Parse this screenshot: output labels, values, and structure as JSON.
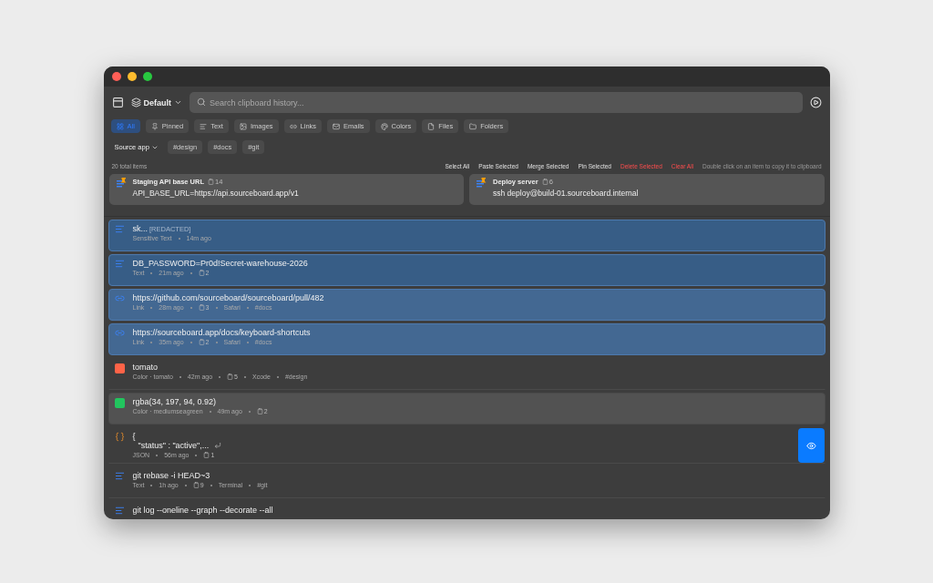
{
  "toolbar": {
    "profile": "Default",
    "search_placeholder": "Search clipboard history..."
  },
  "filters": [
    {
      "label": "All",
      "selected": true
    },
    {
      "label": "Pinned",
      "selected": false
    },
    {
      "label": "Text",
      "selected": false
    },
    {
      "label": "Images",
      "selected": false
    },
    {
      "label": "Links",
      "selected": false
    },
    {
      "label": "Emails",
      "selected": false
    },
    {
      "label": "Colors",
      "selected": false
    },
    {
      "label": "Files",
      "selected": false
    },
    {
      "label": "Folders",
      "selected": false
    }
  ],
  "source_app": "Source app",
  "tags": [
    "#design",
    "#docs",
    "#git"
  ],
  "total": "20 total items",
  "actions": [
    {
      "label": "Select All",
      "kind": "normal"
    },
    {
      "label": "Paste Selected",
      "kind": "normal"
    },
    {
      "label": "Merge Selected",
      "kind": "normal"
    },
    {
      "label": "Pin Selected",
      "kind": "normal"
    },
    {
      "label": "Delete Selected",
      "kind": "danger"
    },
    {
      "label": "Clear All",
      "kind": "danger"
    }
  ],
  "hint": "Double click on an item to copy it to clipboard",
  "pinned": [
    {
      "title": "Staging API base URL",
      "count": "14",
      "content": "API_BASE_URL=https://api.sourceboard.app/v1"
    },
    {
      "title": "Deploy server",
      "count": "6",
      "content": "ssh deploy@build-01.sourceboard.internal"
    }
  ],
  "items": [
    {
      "kind": "text",
      "title": "sk...",
      "note": "[REDACTED]",
      "selected": true,
      "highlighted": false,
      "meta": [
        {
          "kind": "text",
          "text": "Sensitive Text"
        },
        {
          "kind": "text",
          "text": "14m ago"
        }
      ]
    },
    {
      "kind": "text",
      "title": "DB_PASSWORD=Pr0d!Secret-warehouse-2026",
      "selected": true,
      "highlighted": false,
      "meta": [
        {
          "kind": "text",
          "text": "Text"
        },
        {
          "kind": "text",
          "text": "21m ago"
        },
        {
          "kind": "count",
          "text": "2"
        }
      ]
    },
    {
      "kind": "link",
      "title": "https://github.com/sourceboard/sourceboard/pull/482",
      "selected": true,
      "highlighted": false,
      "meta": [
        {
          "kind": "text",
          "text": "Link"
        },
        {
          "kind": "text",
          "text": "28m ago"
        },
        {
          "kind": "count",
          "text": "3"
        },
        {
          "kind": "text",
          "text": "Safari"
        },
        {
          "kind": "text",
          "text": "#docs"
        }
      ]
    },
    {
      "kind": "link",
      "title": "https://sourceboard.app/docs/keyboard-shortcuts",
      "selected": true,
      "highlighted": false,
      "meta": [
        {
          "kind": "text",
          "text": "Link"
        },
        {
          "kind": "text",
          "text": "35m ago"
        },
        {
          "kind": "count",
          "text": "2"
        },
        {
          "kind": "text",
          "text": "Safari"
        },
        {
          "kind": "text",
          "text": "#docs"
        }
      ]
    },
    {
      "kind": "color",
      "color": "#ff6347",
      "title": "tomato",
      "selected": false,
      "highlighted": false,
      "meta": [
        {
          "kind": "text",
          "text": "Color · tomato"
        },
        {
          "kind": "text",
          "text": "42m ago"
        },
        {
          "kind": "count",
          "text": "5"
        },
        {
          "kind": "text",
          "text": "Xcode"
        },
        {
          "kind": "text",
          "text": "#design"
        }
      ]
    },
    {
      "kind": "color",
      "color": "#22c55e",
      "title": "rgba(34, 197, 94, 0.92)",
      "selected": false,
      "highlighted": true,
      "meta": [
        {
          "kind": "text",
          "text": "Color · mediumseagreen"
        },
        {
          "kind": "text",
          "text": "49m ago"
        },
        {
          "kind": "count",
          "text": "2"
        }
      ]
    },
    {
      "kind": "json",
      "title": "{",
      "second_line": "\"status\" : \"active\",...",
      "preview": true,
      "selected": false,
      "highlighted": false,
      "meta": [
        {
          "kind": "text",
          "text": "JSON"
        },
        {
          "kind": "text",
          "text": "56m ago"
        },
        {
          "kind": "count",
          "text": "1"
        }
      ]
    },
    {
      "kind": "text",
      "title": "git rebase -i HEAD~3",
      "selected": false,
      "highlighted": false,
      "meta": [
        {
          "kind": "text",
          "text": "Text"
        },
        {
          "kind": "text",
          "text": "1h ago"
        },
        {
          "kind": "count",
          "text": "9"
        },
        {
          "kind": "text",
          "text": "Terminal"
        },
        {
          "kind": "text",
          "text": "#git"
        }
      ]
    },
    {
      "kind": "text",
      "title": "git log --oneline --graph --decorate --all",
      "selected": false,
      "highlighted": false
    }
  ]
}
